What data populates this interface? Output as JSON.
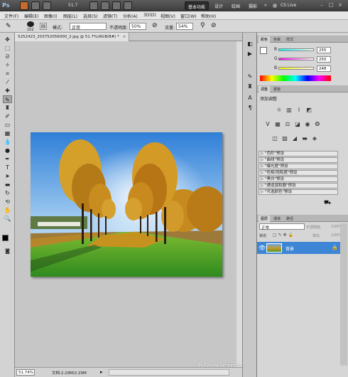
{
  "appbar": {
    "logo": "Ps",
    "zoom": "51.7",
    "workspaces": [
      "基本功能",
      "设计",
      "绘画",
      "摄影"
    ],
    "more": "»",
    "cslive": "CS Live",
    "win_min": "–",
    "win_max": "□",
    "win_close": "×"
  },
  "menu": [
    "文件(F)",
    "编辑(E)",
    "图像(I)",
    "图层(L)",
    "选择(S)",
    "滤镜(T)",
    "分析(A)",
    "3D(D)",
    "视图(V)",
    "窗口(W)",
    "帮助(H)"
  ],
  "options": {
    "brush_size": "102",
    "mode_label": "模式:",
    "mode_value": "正常",
    "opacity_label": "不透明度:",
    "opacity_value": "50%",
    "flow_label": "流量:",
    "flow_value": "54%"
  },
  "document": {
    "tab_title": "5252423_203752056000_2.jpg @ 51.7%(RGB/8#) *",
    "tab_close": "×",
    "zoom": "51.74%",
    "doc_info": "文档:2.29M/2.29M"
  },
  "color_panel": {
    "tabs": [
      "颜色",
      "色板",
      "样式"
    ],
    "R": "255",
    "G": "250",
    "B": "248",
    "r_label": "R",
    "g_label": "G",
    "b_label": "B"
  },
  "adjust_panel": {
    "tabs": [
      "调整",
      "蒙版"
    ],
    "title": "添加调整",
    "presets": [
      "\"色阶\"预设",
      "\"曲线\"预设",
      "\"曝光度\"预设",
      "\"色相/饱和度\"预设",
      "\"黑白\"预设",
      "\"通道混和器\"预设",
      "\"可选颜色\"预设"
    ]
  },
  "layers_panel": {
    "tabs": [
      "图层",
      "通道",
      "路径"
    ],
    "blend": "正常",
    "opacity_label": "不透明度:",
    "opacity": "100%",
    "lock_label": "锁定:",
    "fill_label": "填充:",
    "fill": "100%",
    "layer_name": "背景"
  },
  "watermark": "blog.sina.com.cn/libinghui1009",
  "colors": {
    "accent": "#3a78c8",
    "selected_layer": "#3d86d6",
    "app_bar": "#4a4a4a"
  }
}
